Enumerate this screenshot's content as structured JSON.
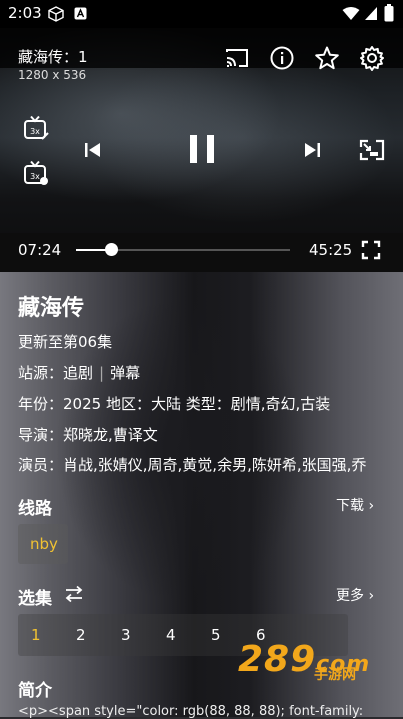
{
  "status_bar": {
    "time": "2:03"
  },
  "player": {
    "title": "藏海传：1",
    "resolution": "1280 x 536",
    "current_time": "07:24",
    "total_time": "45:25",
    "progress": 0.163
  },
  "detail": {
    "name": "藏海传",
    "update": "更新至第06集",
    "source_label": "站源：",
    "source_value": "追剧",
    "source_alt": "弹幕",
    "meta": "年份：2025  地区：大陆  类型：剧情,奇幻,古装",
    "director": "导演：郑晓龙,曹译文",
    "cast": "演员：肖战,张婧仪,周奇,黄觉,余男,陈妍希,张国强,乔"
  },
  "routes": {
    "heading": "线路",
    "more": "下载",
    "items": [
      "nby"
    ]
  },
  "episodes": {
    "heading": "选集",
    "more": "更多",
    "items": [
      "1",
      "2",
      "3",
      "4",
      "5",
      "6"
    ],
    "selected": "1"
  },
  "intro": {
    "heading": "简介",
    "text": "<p><span style=\"color: rgb(88, 88, 88); font-family:"
  },
  "watermark": {
    "number": "289",
    "suffix": "com",
    "sub": "手游网"
  },
  "colors": {
    "accent": "#f1c232",
    "watermark": "#f2a71b"
  }
}
